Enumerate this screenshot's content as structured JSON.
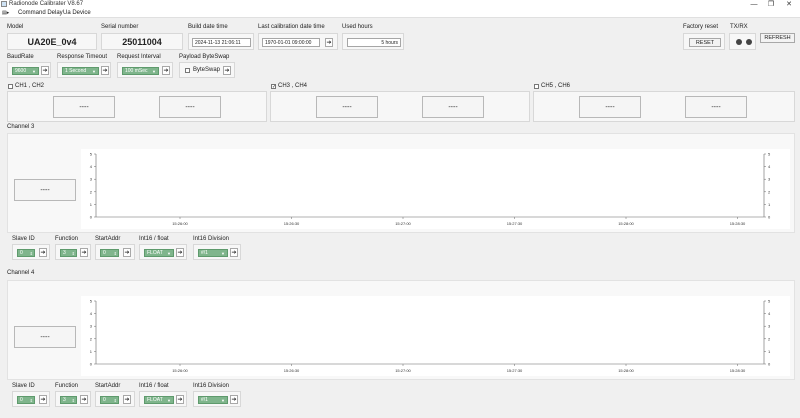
{
  "window": {
    "title": "Radionode Calibrater V8.67",
    "minimize": "—",
    "maximize": "❐",
    "close": "✕"
  },
  "menu": {
    "items": [
      "Command Delay",
      "Ua Device"
    ]
  },
  "info": {
    "model_label": "Model",
    "model_value": "UA20E_0v4",
    "serial_label": "Serial number",
    "serial_value": "25011004",
    "build_label": "Build date time",
    "build_value": "2024-11-13 21:06:11",
    "calib_label": "Last calibration date time",
    "calib_value": "1970-01-01 09:00:00",
    "hours_label": "Used hours",
    "hours_value": "5 hours",
    "factory_label": "Factory reset",
    "reset_button": "RESET",
    "txrx_label": "TX/RX",
    "refresh_button": "REFRESH"
  },
  "settings": {
    "baud_label": "BaudRate",
    "baud_value": "9600",
    "timeout_label": "Response Timeout",
    "timeout_value": "1 Second",
    "interval_label": "Request Interval",
    "interval_value": "100 mSec",
    "byteswap_label": "Payload ByteSwap",
    "byteswap_checkbox": "ByteSwap"
  },
  "channels": {
    "ch12": {
      "label": "CH1 , CH2",
      "checked": false,
      "v1": "----",
      "v2": "----"
    },
    "ch34": {
      "label": "CH3 , CH4",
      "checked": true,
      "v1": "----",
      "v2": "----"
    },
    "ch56": {
      "label": "CH5 , CH6",
      "checked": false,
      "v1": "----",
      "v2": "----"
    }
  },
  "plots": [
    {
      "title": "Channel 3",
      "value": "----",
      "slave_label": "Slave ID",
      "slave_value": "0",
      "function_label": "Function",
      "function_value": "3",
      "startaddr_label": "StartAddr",
      "startaddr_value": "0",
      "int16_label": "Int16 / float",
      "int16_value": "FLOAT",
      "division_label": "Int16 Division",
      "division_value": "#/1"
    },
    {
      "title": "Channel 4",
      "value": "----",
      "slave_label": "Slave ID",
      "slave_value": "0",
      "function_label": "Function",
      "function_value": "3",
      "startaddr_label": "StartAddr",
      "startaddr_value": "0",
      "int16_label": "Int16 / float",
      "int16_value": "FLOAT",
      "division_label": "Int16 Division",
      "division_value": "#/1"
    }
  ],
  "chart_data": [
    {
      "type": "line",
      "x_ticks": [
        "15:26:00",
        "15:26:30",
        "15:27:00",
        "15:27:30",
        "15:28:00",
        "15:28:30"
      ],
      "y_ticks": [
        0,
        1,
        2,
        3,
        4,
        5
      ],
      "ylim": [
        0,
        5
      ],
      "series": []
    },
    {
      "type": "line",
      "x_ticks": [
        "15:26:00",
        "15:26:30",
        "15:27:00",
        "15:27:30",
        "15:28:00",
        "15:28:30"
      ],
      "y_ticks": [
        0,
        1,
        2,
        3,
        4,
        5
      ],
      "ylim": [
        0,
        5
      ],
      "series": []
    }
  ],
  "colors": {
    "combo_green": "#7fb58c",
    "background": "#f0f0f0"
  }
}
